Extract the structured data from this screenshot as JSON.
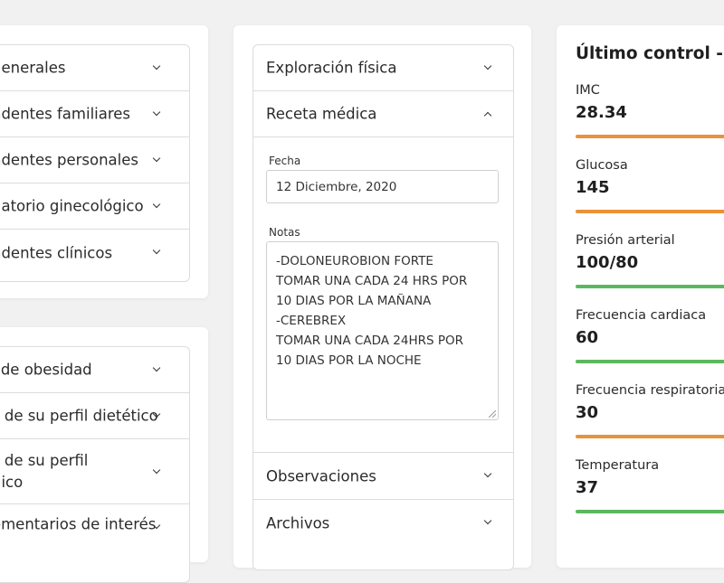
{
  "left_top_accordion": {
    "items": [
      {
        "label": "generales"
      },
      {
        "label": "ndentes familiares"
      },
      {
        "label": "ndentes personales"
      },
      {
        "label": "gatorio ginecológico"
      },
      {
        "label": "ndentes clínicos"
      }
    ]
  },
  "left_bottom_accordion": {
    "items": [
      {
        "label": "l de obesidad"
      },
      {
        "label": "s de su perfil dietético"
      },
      {
        "label_line1": "s de su perfil",
        "label_line2": "gico"
      },
      {
        "label": "omentarios de interés"
      }
    ]
  },
  "middle_accordion": {
    "exploracion": "Exploración física",
    "receta": "Receta médica",
    "fecha_label": "Fecha",
    "fecha_value": "12 Diciembre, 2020",
    "notas_label": "Notas",
    "notas_lines": [
      "-DOLONEUROBION FORTE",
      "TOMAR UNA CADA 24 HRS POR",
      "10 DIAS POR LA MAÑANA",
      "-CEREBREX",
      "TOMAR UNA CADA 24HRS POR",
      "10 DIAS POR LA NOCHE"
    ],
    "observaciones": "Observaciones",
    "archivos": "Archivos"
  },
  "right_panel": {
    "title": "Último control -",
    "metrics": [
      {
        "label": "IMC",
        "value": "28.34",
        "status_color": "#e8923a"
      },
      {
        "label": "Glucosa",
        "value": "145",
        "status_color": "#e8923a"
      },
      {
        "label": "Presión arterial",
        "value": "100/80",
        "status_color": "#5cb85c"
      },
      {
        "label": "Frecuencia cardiaca",
        "value": "60",
        "status_color": "#5cb85c"
      },
      {
        "label": "Frecuencia respiratoria",
        "value": "30",
        "status_color": "#e8923a"
      },
      {
        "label": "Temperatura",
        "value": "37",
        "status_color": "#5cb85c"
      }
    ]
  }
}
